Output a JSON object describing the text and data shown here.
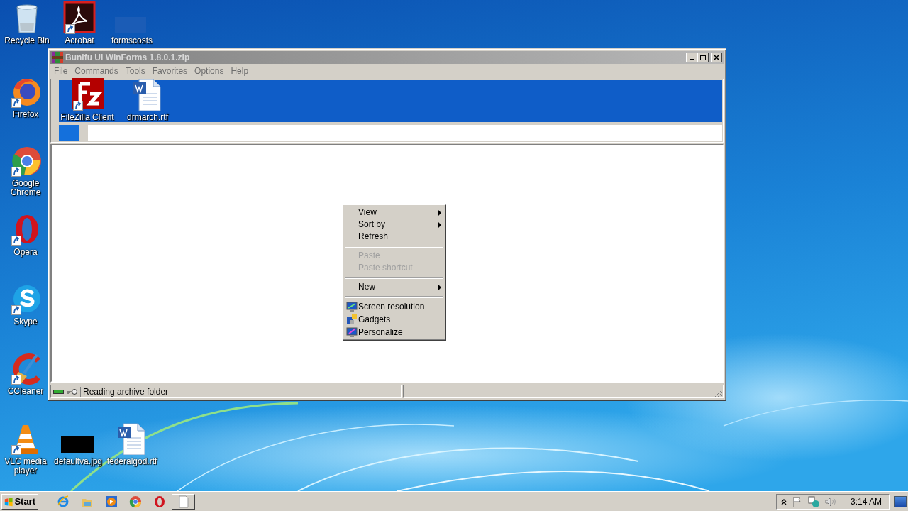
{
  "desktop": {
    "icons": [
      {
        "label": "Recycle Bin",
        "kind": "recycle",
        "shortcut": false
      },
      {
        "label": "Acrobat",
        "kind": "acrobat",
        "shortcut": true
      },
      {
        "label": "formscosts",
        "kind": "file",
        "shortcut": false
      },
      {
        "label": "Firefox",
        "kind": "firefox",
        "shortcut": true
      },
      {
        "label": "Google Chrome",
        "kind": "chrome",
        "shortcut": true
      },
      {
        "label": "Opera",
        "kind": "opera",
        "shortcut": true
      },
      {
        "label": "Skype",
        "kind": "skype",
        "shortcut": true
      },
      {
        "label": "CCleaner",
        "kind": "ccleaner",
        "shortcut": true
      },
      {
        "label": "VLC media player",
        "kind": "vlc",
        "shortcut": true
      },
      {
        "label": "defaultva.jpg",
        "kind": "thumbnail",
        "shortcut": false
      },
      {
        "label": "federalgod.rtf",
        "kind": "word",
        "shortcut": false
      }
    ]
  },
  "window": {
    "title": "Bunifu UI WinForms 1.8.0.1.zip",
    "menu": [
      "File",
      "Commands",
      "Tools",
      "Favorites",
      "Options",
      "Help"
    ],
    "toolbar_icons": [
      {
        "label": "FileZilla Client",
        "kind": "filezilla",
        "shortcut": true
      },
      {
        "label": "drmarch.rtf",
        "kind": "word",
        "shortcut": false
      }
    ],
    "status_bar": {
      "text": "Reading archive folder"
    }
  },
  "context_menu": {
    "items": [
      {
        "kind": "item",
        "label": "View",
        "submenu": true,
        "disabled": false
      },
      {
        "kind": "item",
        "label": "Sort by",
        "submenu": true,
        "disabled": false
      },
      {
        "kind": "item",
        "label": "Refresh",
        "submenu": false,
        "disabled": false
      },
      {
        "kind": "separator"
      },
      {
        "kind": "item",
        "label": "Paste",
        "submenu": false,
        "disabled": true
      },
      {
        "kind": "item",
        "label": "Paste shortcut",
        "submenu": false,
        "disabled": true
      },
      {
        "kind": "separator"
      },
      {
        "kind": "item",
        "label": "New",
        "submenu": true,
        "disabled": false
      },
      {
        "kind": "separator"
      },
      {
        "kind": "icon-item",
        "label": "Screen resolution",
        "submenu": false,
        "disabled": false
      },
      {
        "kind": "icon-item",
        "label": "Gadgets",
        "submenu": false,
        "disabled": false
      },
      {
        "kind": "icon-item",
        "label": "Personalize",
        "submenu": false,
        "disabled": false
      }
    ]
  },
  "taskbar": {
    "start": "Start",
    "apps": [
      {
        "kind": "ie"
      },
      {
        "kind": "explorer"
      },
      {
        "kind": "media"
      },
      {
        "kind": "chrome"
      },
      {
        "kind": "opera"
      },
      {
        "kind": "window"
      }
    ],
    "clock": "3:14 AM"
  }
}
